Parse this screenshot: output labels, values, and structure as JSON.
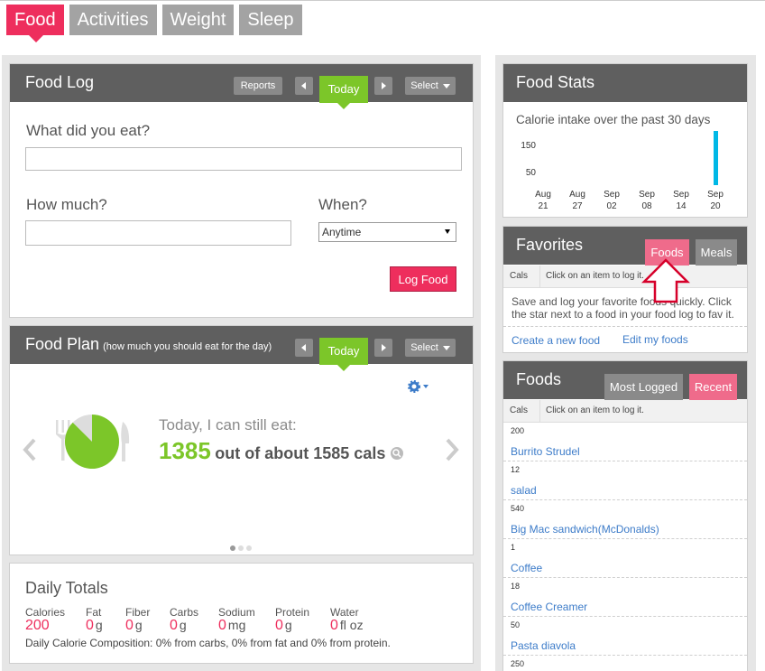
{
  "nav_tabs": [
    "Food",
    "Activities",
    "Weight",
    "Sleep"
  ],
  "food_log": {
    "title": "Food Log",
    "reports": "Reports",
    "today": "Today",
    "select": "Select",
    "q_what": "What did you eat?",
    "what_value": "",
    "q_how_much": "How much?",
    "how_much_value": "",
    "q_when": "When?",
    "when_value": "Anytime",
    "log_button": "Log Food"
  },
  "food_plan": {
    "title": "Food Plan",
    "subtitle": "(how much you should eat for the day)",
    "today": "Today",
    "select": "Select",
    "can_eat": "Today, I can still eat:",
    "remaining": "1385",
    "out_of": "out of about 1585 cals",
    "pie_remaining_fraction": 0.874,
    "colors": {
      "accent_green": "#7cc629",
      "pink": "#ee2e5d"
    }
  },
  "daily_totals": {
    "title": "Daily Totals",
    "labels": [
      "Calories",
      "Fat",
      "Fiber",
      "Carbs",
      "Sodium",
      "Protein",
      "Water"
    ],
    "values": [
      "200",
      "0",
      "0",
      "0",
      "0",
      "0",
      "0"
    ],
    "units": [
      "",
      "g",
      "g",
      "g",
      "mg",
      "g",
      "fl oz"
    ],
    "composition": "Daily Calorie Composition: 0% from carbs, 0% from fat and 0% from protein."
  },
  "food_stats": {
    "title": "Food Stats",
    "subtitle": "Calorie intake over the past 30 days"
  },
  "chart_data": {
    "type": "bar",
    "title": "Calorie intake over the past 30 days",
    "yticks": [
      "150",
      "50"
    ],
    "x_ticks": [
      [
        "Aug",
        "21"
      ],
      [
        "Aug",
        "27"
      ],
      [
        "Sep",
        "02"
      ],
      [
        "Sep",
        "08"
      ],
      [
        "Sep",
        "14"
      ],
      [
        "Sep",
        "20"
      ]
    ],
    "series": [
      {
        "x": "Sep 20",
        "value": 200
      }
    ],
    "ylim": [
      0,
      200
    ],
    "color": "#00b8e6"
  },
  "favorites": {
    "title": "Favorites",
    "tab_foods": "Foods",
    "tab_meals": "Meals",
    "col_cals": "Cals",
    "col_hint": "Click on an item to log it.",
    "message": "Save and log your favorite foods quickly. Click the star next to a food in your food log to fav it.",
    "link_create": "Create a new food",
    "link_edit": "Edit my foods"
  },
  "foods": {
    "title": "Foods",
    "tab_most": "Most Logged",
    "tab_recent": "Recent",
    "col_cals": "Cals",
    "col_hint": "Click on an item to log it.",
    "items": [
      {
        "cals": "200",
        "name": "Burrito Strudel"
      },
      {
        "cals": "12",
        "name": "salad"
      },
      {
        "cals": "540",
        "name": "Big Mac sandwich(McDonalds)"
      },
      {
        "cals": "1",
        "name": "Coffee"
      },
      {
        "cals": "18",
        "name": "Coffee Creamer"
      },
      {
        "cals": "50",
        "name": "Pasta diavola"
      },
      {
        "cals": "250",
        "name": ""
      }
    ]
  }
}
